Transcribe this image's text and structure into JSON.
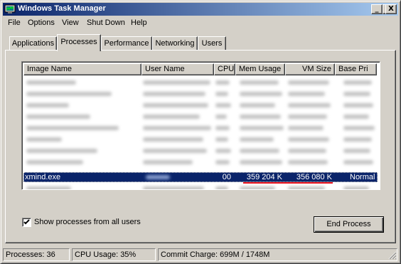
{
  "window": {
    "title": "Windows Task Manager"
  },
  "title_buttons": {
    "minimize": "_",
    "maximize": "□",
    "close": "X"
  },
  "menu": [
    {
      "label": "File"
    },
    {
      "label": "Options"
    },
    {
      "label": "View"
    },
    {
      "label": "Shut Down"
    },
    {
      "label": "Help"
    }
  ],
  "tabs": [
    {
      "label": "Applications"
    },
    {
      "label": "Processes",
      "active": true
    },
    {
      "label": "Performance"
    },
    {
      "label": "Networking"
    },
    {
      "label": "Users"
    }
  ],
  "columns": [
    "Image Name",
    "User Name",
    "CPU",
    "Mem Usage",
    "VM Size",
    "Base Pri"
  ],
  "selected_process": {
    "image_name": "xmind.exe",
    "user_name": "",
    "cpu": "00",
    "mem_usage": "359 204 K",
    "vm_size": "356 080 K",
    "base_pri": "Normal"
  },
  "show_all_users": {
    "label": "Show processes from all users",
    "checked": true
  },
  "end_process_button": "End Process",
  "status": {
    "processes": "Processes: 36",
    "cpu_usage": "CPU Usage: 35%",
    "commit_charge": "Commit Charge: 699M / 1748M"
  },
  "colors": {
    "title_gradient_start": "#0a246a",
    "title_gradient_end": "#a6caf0",
    "selection": "#0a246a",
    "annotation_underline": "#e8101c",
    "face": "#d4d0c8"
  }
}
